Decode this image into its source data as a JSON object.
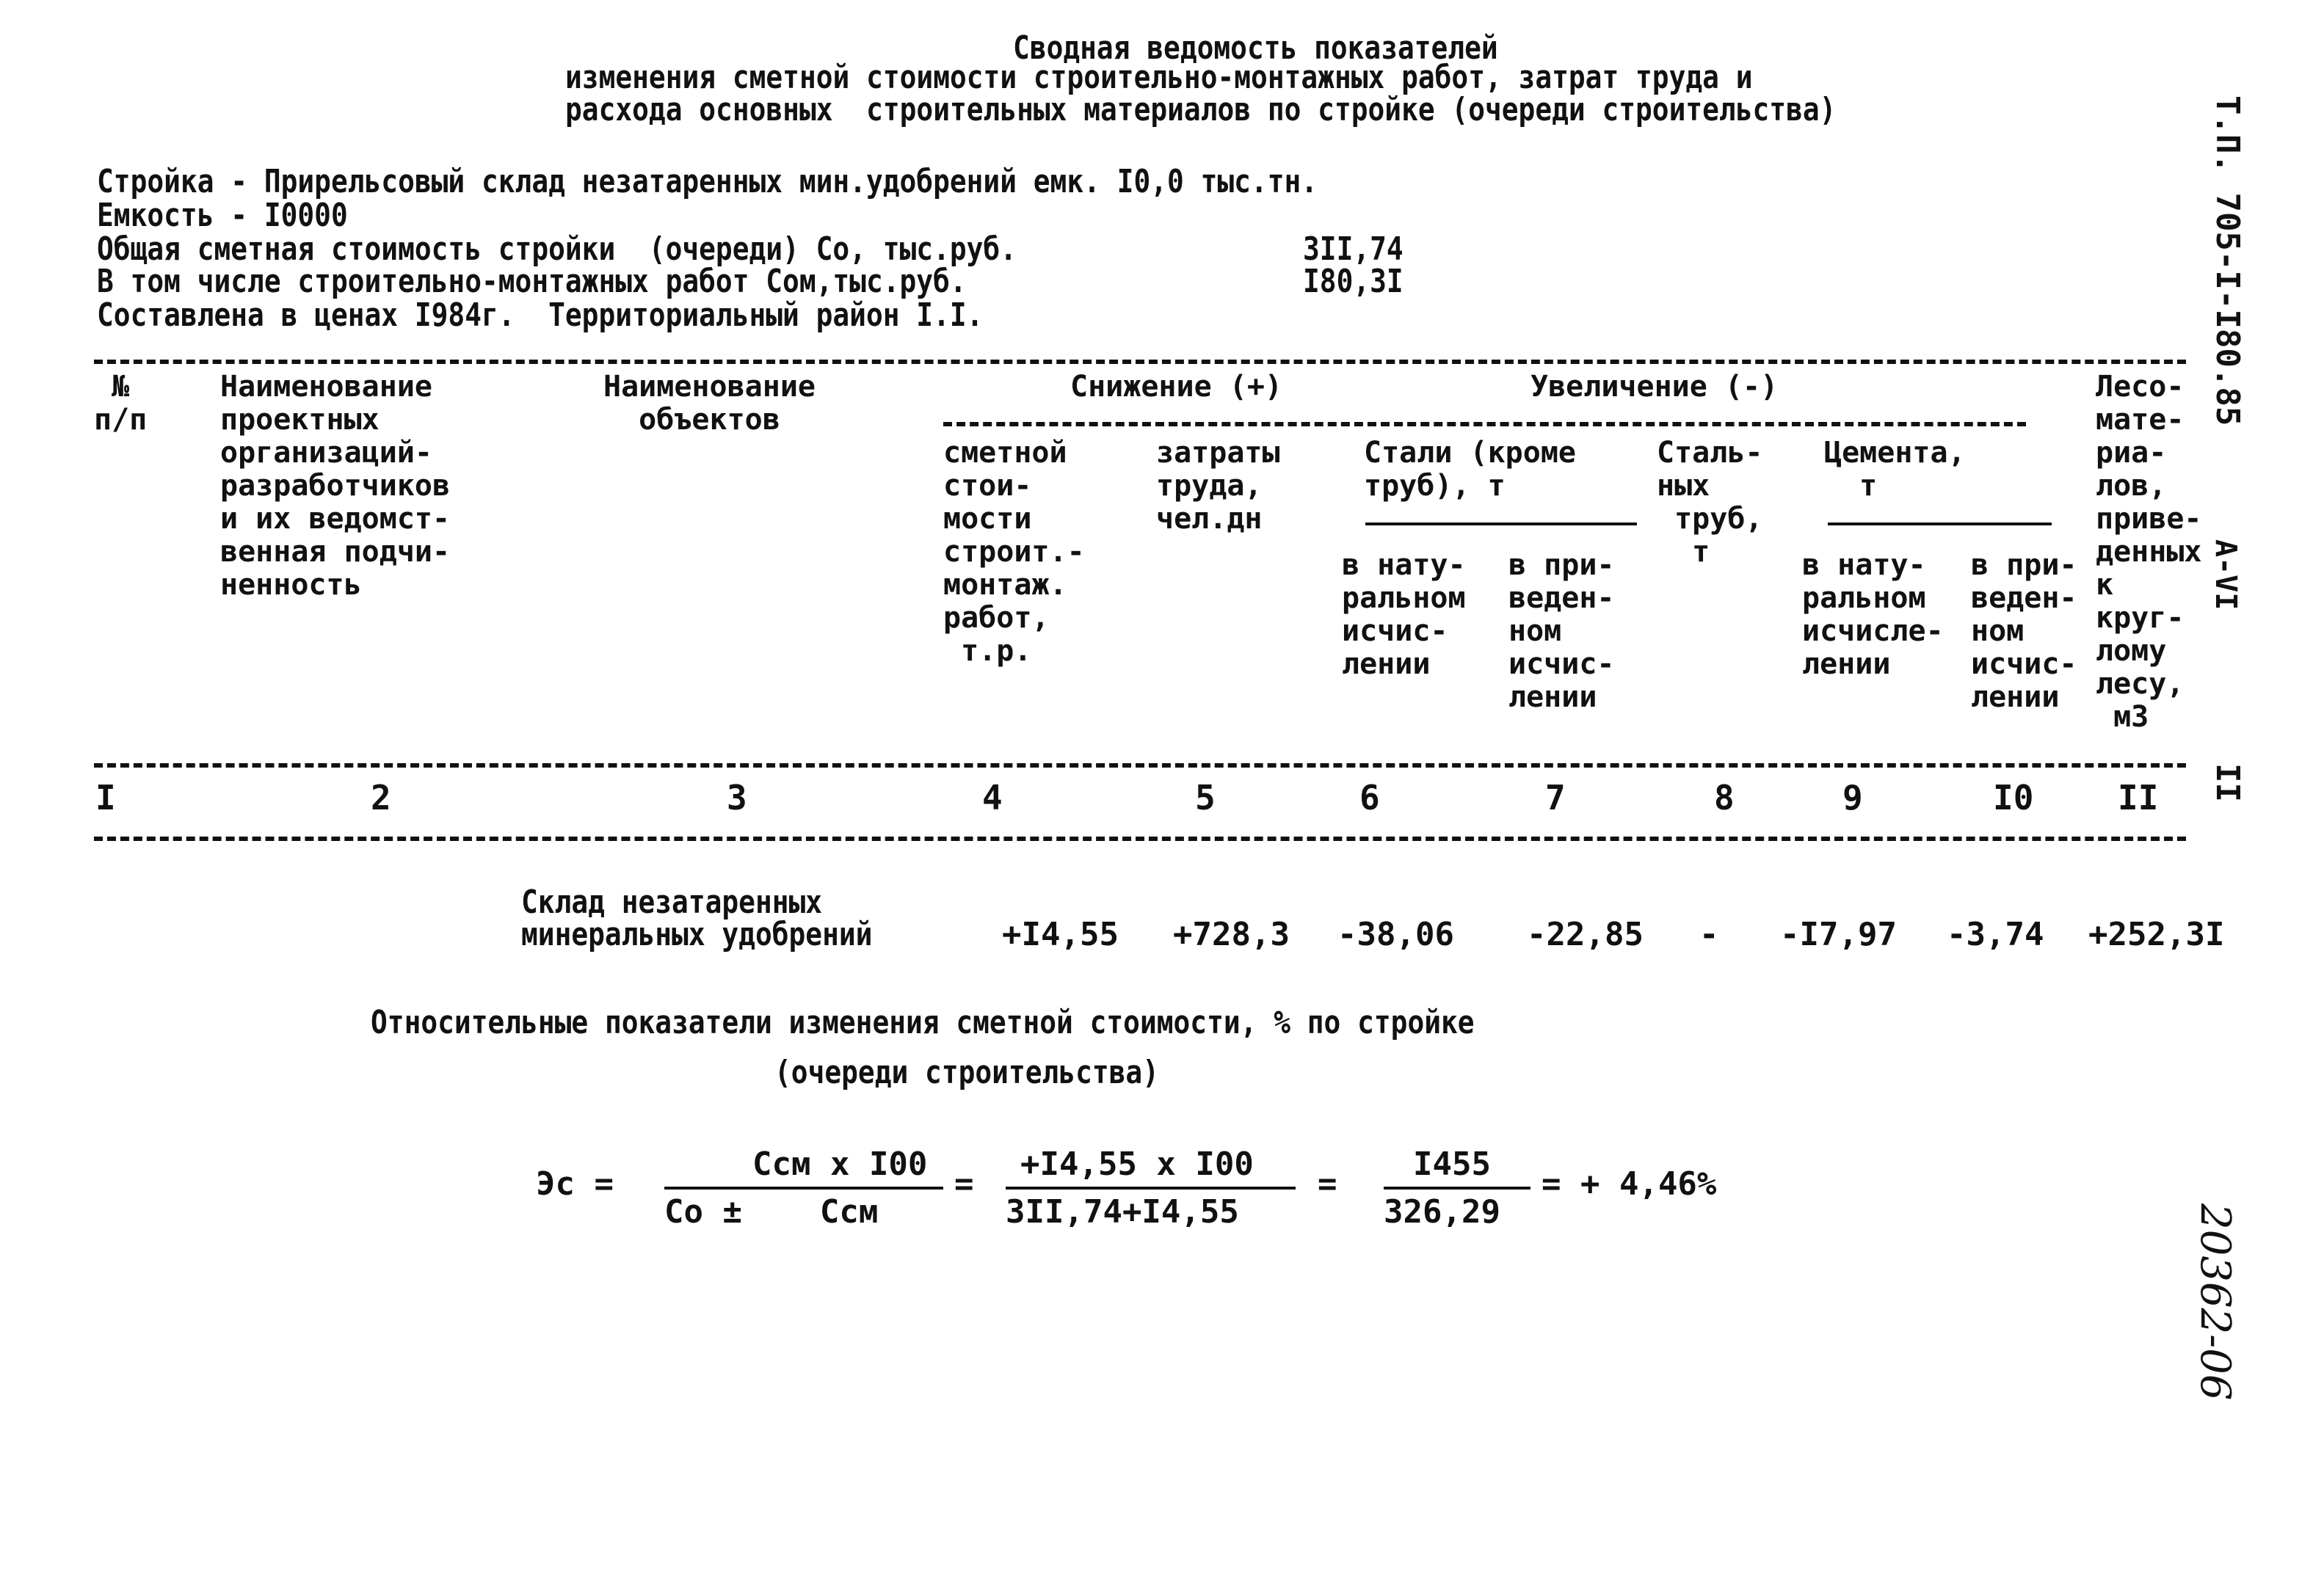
{
  "title": {
    "line1": "Сводная ведомость показателей",
    "line2": "изменения сметной стоимости строительно-монтажных работ, затрат труда и",
    "line3": "расхода основных  строительных материалов по стройке (очереди строительства)"
  },
  "info": {
    "stroika": "Стройка - Прирельсовый склад незатаренных мин.удобрений емк. I0,0 тыс.тн.",
    "emkost": "Емкость - I0000",
    "total_label": "Общая сметная стоимость стройки  (очереди) Со, тыс.руб.",
    "total_value": "3II,74",
    "smr_label": "В том числе строительно-монтажных работ Сом,тыс.руб.",
    "smr_value": "I80,3I",
    "prices": "Составлена в ценах I984г.  Территориальный район I.I."
  },
  "table": {
    "headers": {
      "col1": "№\nп/п",
      "col2": "Наименование\nпроектных\nорганизаций-\nразработчиков\nи их ведомст-\nвенная подчи-\nненность",
      "col3": "Наименование\n  объектов",
      "group_decrease": "Снижение (+)",
      "group_increase": "Увеличение (-)",
      "col4": "сметной\nстои-\nмости\nстроит.-\nмонтаж.\nработ,\n т.р.",
      "col5": "затраты\nтруда,\nчел.дн",
      "steel_group": "Стали (кроме\nтруб), т",
      "col6": "в нату-\nральном\nисчис-\nлении",
      "col7": "в при-\nведен-\nном\nисчис-\nлении",
      "col8": "Сталь-\nных\n труб,\n  т",
      "cement_group": "Цемента,\n  т",
      "col9": "в нату-\nральном\nисчисле-\nлении",
      "col10": "в при-\nведен-\nном\nисчис-\nлении",
      "col11": "Лесо-\nмате-\nриа-\nлов,\nприве-\nденных\nк\nкруг-\nлому\nлесу,\n м3"
    },
    "column_numbers": [
      "I",
      "2",
      "3",
      "4",
      "5",
      "6",
      "7",
      "8",
      "9",
      "I0",
      "II"
    ],
    "rows": [
      {
        "object_line1": "Склад незатаренных",
        "object_line2": "минеральных удобрений",
        "values": [
          "+I4,55",
          "+728,3",
          "-38,06",
          "-22,85",
          "-",
          "-I7,97",
          "-3,74",
          "+252,3I"
        ]
      }
    ]
  },
  "relative": {
    "heading": "Относительные показатели изменения сметной стоимости, % по стройке",
    "subheading": "(очереди строительства)"
  },
  "formula": {
    "lhs": "Эс =",
    "frac1_num": "Ссм х I00",
    "frac1_den": "Со ±    Ссм",
    "eq1": "=",
    "frac2_num": "+I4,55 х I00",
    "frac2_den": "3II,74+I4,55",
    "eq2": "=",
    "frac3_num": "I455",
    "frac3_den": "326,29",
    "result": "= + 4,46%"
  },
  "margin": {
    "doc_code": "Т.П. 705-I-I80.85",
    "album": "А-VI",
    "sheet": "II",
    "handwritten": "20362-06"
  }
}
